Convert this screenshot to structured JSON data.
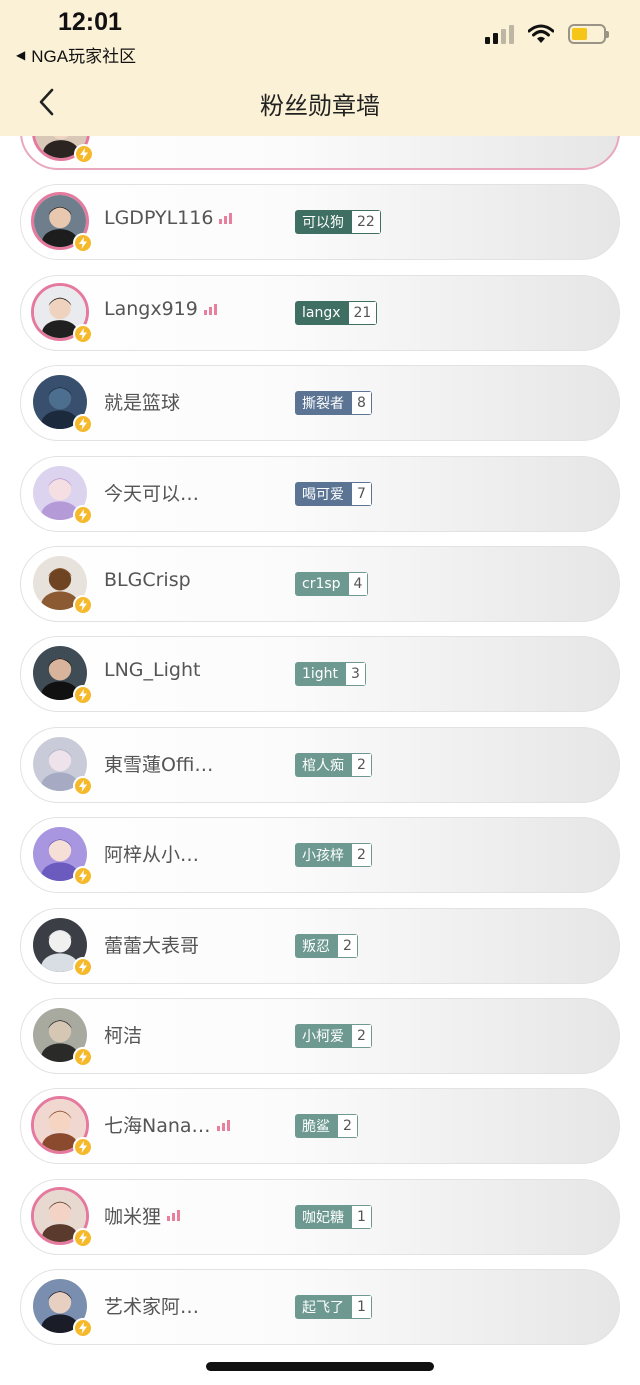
{
  "status_bar": {
    "time": "12:01",
    "back_app": "NGA玩家社区"
  },
  "header": {
    "title": "粉丝勋章墙"
  },
  "colors": {
    "header_bg": "#fbf1d6",
    "dark_green": "#3f6e62",
    "slate_blue": "#5b7494",
    "sage": "#6d9990",
    "pink": "#e57a9e",
    "bolt": "#f6b92b"
  },
  "fans": [
    {
      "name": "",
      "medal": "",
      "level": "",
      "color": "dark_green",
      "ring": true,
      "lvl_icon": true,
      "avatar": "avatar-1"
    },
    {
      "name": "LGDPYL116",
      "medal": "可以狗",
      "level": "22",
      "color": "dark_green",
      "ring": true,
      "lvl_icon": true,
      "avatar": "avatar-2"
    },
    {
      "name": "Langx919",
      "medal": "langx",
      "level": "21",
      "color": "dark_green",
      "ring": true,
      "lvl_icon": true,
      "avatar": "avatar-3"
    },
    {
      "name": "就是篮球",
      "medal": "撕裂者",
      "level": "8",
      "color": "slate_blue",
      "ring": false,
      "lvl_icon": false,
      "avatar": "avatar-4"
    },
    {
      "name": "今天可以…",
      "medal": "喝可爱",
      "level": "7",
      "color": "slate_blue",
      "ring": false,
      "lvl_icon": false,
      "avatar": "avatar-5"
    },
    {
      "name": "BLGCrisp",
      "medal": "cr1sp",
      "level": "4",
      "color": "sage",
      "ring": false,
      "lvl_icon": false,
      "avatar": "avatar-6"
    },
    {
      "name": "LNG_Light",
      "medal": "1ight",
      "level": "3",
      "color": "sage",
      "ring": false,
      "lvl_icon": false,
      "avatar": "avatar-7"
    },
    {
      "name": "東雪蓮Offi…",
      "medal": "棺人痴",
      "level": "2",
      "color": "sage",
      "ring": false,
      "lvl_icon": false,
      "avatar": "avatar-8"
    },
    {
      "name": "阿梓从小…",
      "medal": "小孩梓",
      "level": "2",
      "color": "sage",
      "ring": false,
      "lvl_icon": false,
      "avatar": "avatar-9"
    },
    {
      "name": "蕾蕾大表哥",
      "medal": "叛忍",
      "level": "2",
      "color": "sage",
      "ring": false,
      "lvl_icon": false,
      "avatar": "avatar-10"
    },
    {
      "name": "柯洁",
      "medal": "小柯爱",
      "level": "2",
      "color": "sage",
      "ring": false,
      "lvl_icon": false,
      "avatar": "avatar-11"
    },
    {
      "name": "七海Nana…",
      "medal": "脆鲨",
      "level": "2",
      "color": "sage",
      "ring": true,
      "lvl_icon": true,
      "avatar": "avatar-12"
    },
    {
      "name": "咖米狸",
      "medal": "咖妃糖",
      "level": "1",
      "color": "sage",
      "ring": true,
      "lvl_icon": true,
      "avatar": "avatar-13"
    },
    {
      "name": "艺术家阿…",
      "medal": "起飞了",
      "level": "1",
      "color": "sage",
      "ring": false,
      "lvl_icon": false,
      "avatar": "avatar-14"
    }
  ]
}
